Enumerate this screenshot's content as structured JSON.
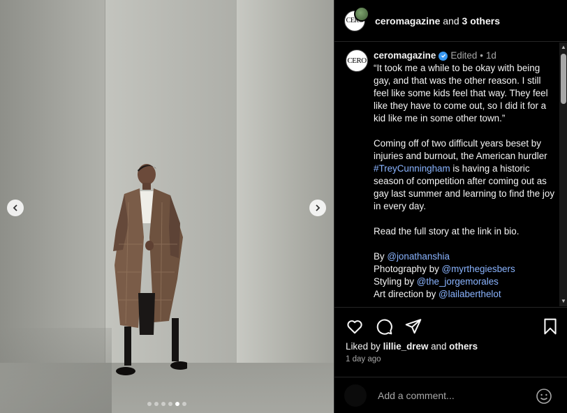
{
  "header": {
    "account": "ceromagazine",
    "and_text": "and",
    "others_text": "3 others",
    "avatar_text": "CERO"
  },
  "post": {
    "username": "ceromagazine",
    "edited": "Edited",
    "separator": "•",
    "age": "1d",
    "avatar_text": "CERO",
    "quote": "“It took me a while to be okay with being gay, and that was the other reason. I still feel like some kids feel that way. They feel like they have to come out, so I did it for a kid like me in some other town.”",
    "body_before": "Coming off of two difficult years beset by injuries and burnout, the American hurdler ",
    "hashtag": "#TreyCunningham",
    "body_after": " is having a historic season of competition after coming out as gay last summer and learning to find the joy in every day.",
    "read_more": "Read the full story at the link in bio.",
    "credits": [
      {
        "label": "By ",
        "handle": "@jonathanshia"
      },
      {
        "label": "Photography by ",
        "handle": "@myrthegiesbers"
      },
      {
        "label": "Styling by ",
        "handle": "@the_jorgemorales"
      },
      {
        "label": "Art direction by ",
        "handle": "@lailaberthelot"
      }
    ]
  },
  "actions": {
    "liked_prefix": "Liked by",
    "liked_user": "lillie_drew",
    "liked_and": "and",
    "liked_others": "others",
    "time": "1 day ago"
  },
  "comment": {
    "placeholder": "Add a comment..."
  },
  "carousel": {
    "total_slides": 6,
    "active_index": 4
  },
  "colors": {
    "accent_link": "#8ab4ff",
    "verified": "#3897f0",
    "background": "#000000"
  },
  "icons": [
    "chevron-left-icon",
    "chevron-right-icon",
    "heart-icon",
    "comment-icon",
    "share-icon",
    "bookmark-icon",
    "emoji-icon",
    "verified-icon"
  ]
}
